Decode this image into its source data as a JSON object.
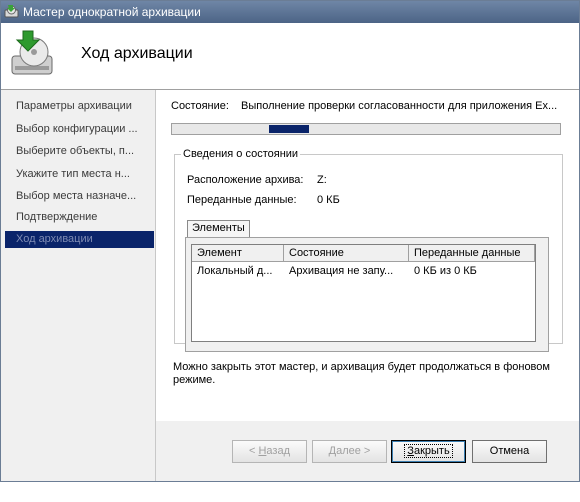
{
  "window": {
    "title": "Мастер однократной архивации",
    "header_title": "Ход архивации"
  },
  "nav": {
    "items": [
      {
        "label": "Параметры архивации",
        "active": false
      },
      {
        "label": "Выбор конфигурации ...",
        "active": false
      },
      {
        "label": "Выберите объекты, п...",
        "active": false
      },
      {
        "label": "Укажите тип места н...",
        "active": false
      },
      {
        "label": "Выбор места назначе...",
        "active": false
      },
      {
        "label": "Подтверждение",
        "active": false
      },
      {
        "label": "Ход архивации",
        "active": true
      }
    ]
  },
  "status": {
    "label": "Состояние:",
    "value": "Выполнение проверки согласованности для приложения Ex...",
    "progress": 0.1
  },
  "details": {
    "legend": "Сведения о состоянии",
    "archive_location_label": "Расположение архива:",
    "archive_location_value": "Z:",
    "transferred_label": "Переданные данные:",
    "transferred_value": "0 КБ",
    "tab_label": "Элементы",
    "table": {
      "columns": [
        "Элемент",
        "Состояние",
        "Переданные данные"
      ],
      "rows": [
        [
          "Локальный д...",
          "Архивация не запу...",
          "0 КБ из 0 КБ"
        ]
      ]
    }
  },
  "info_text": "Можно закрыть этот мастер, и архивация будет продолжаться в фоновом режиме.",
  "buttons": {
    "back": {
      "label": "< Назад",
      "accesskey": "Н",
      "rest": "азад",
      "prefix": "< "
    },
    "next": {
      "label": "Далее >",
      "accesskey": "Д",
      "rest": "алее >"
    },
    "close": {
      "label": "Закрыть",
      "accesskey": "З",
      "rest": "акрыть"
    },
    "cancel": {
      "label": "Отмена"
    }
  },
  "colors": {
    "selection": "#0a246a",
    "titlebar": "#4c6486"
  },
  "icons": {
    "title": "backup-disk-icon",
    "header": "backup-disk-arrow-icon"
  }
}
